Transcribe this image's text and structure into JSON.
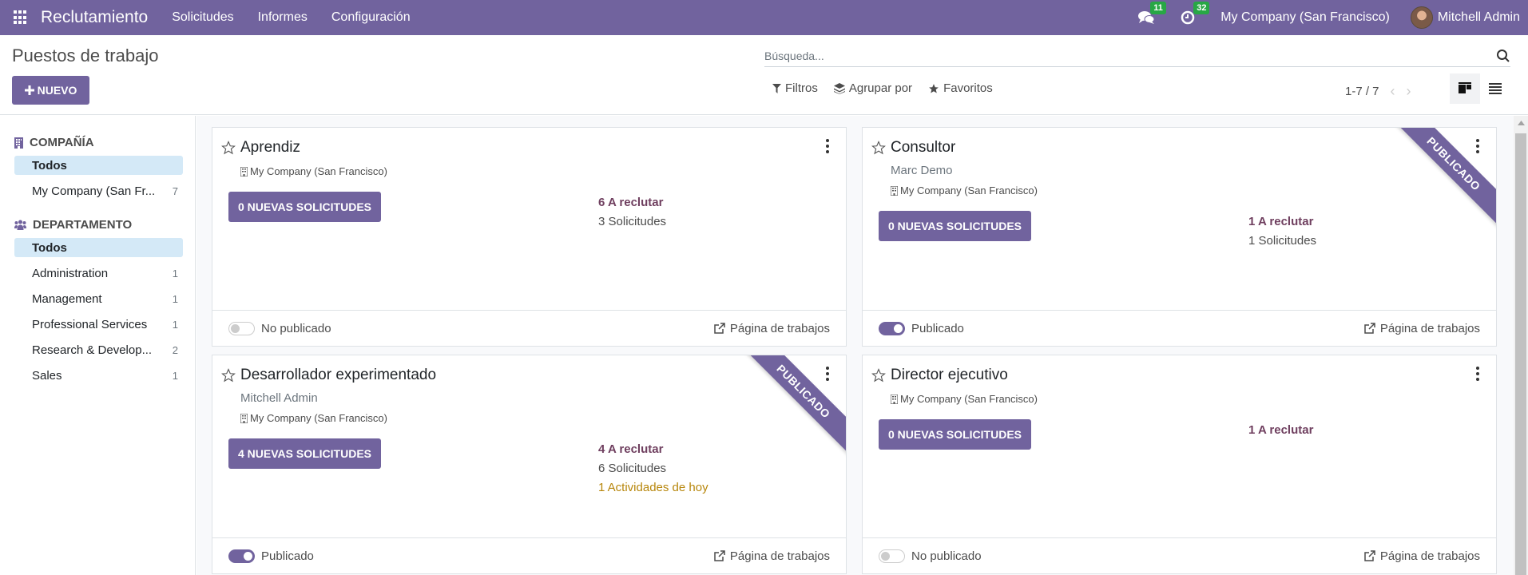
{
  "navbar": {
    "app_name": "Reclutamiento",
    "menu": [
      "Solicitudes",
      "Informes",
      "Configuración"
    ],
    "messages_count": "11",
    "activities_count": "32",
    "company": "My Company (San Francisco)",
    "user": "Mitchell Admin"
  },
  "control_panel": {
    "title": "Puestos de trabajo",
    "new_label": "NUEVO",
    "search_placeholder": "Búsqueda...",
    "filters_label": "Filtros",
    "groupby_label": "Agrupar por",
    "favorites_label": "Favoritos",
    "pager": "1-7 / 7"
  },
  "sidebar": {
    "company_title": "COMPAÑÍA",
    "company_items": [
      {
        "label": "Todos",
        "count": "",
        "active": true
      },
      {
        "label": "My Company (San Fr...",
        "count": "7",
        "active": false
      }
    ],
    "department_title": "DEPARTAMENTO",
    "department_items": [
      {
        "label": "Todos",
        "count": "",
        "active": true
      },
      {
        "label": "Administration",
        "count": "1",
        "active": false
      },
      {
        "label": "Management",
        "count": "1",
        "active": false
      },
      {
        "label": "Professional Services",
        "count": "1",
        "active": false
      },
      {
        "label": "Research & Develop...",
        "count": "2",
        "active": false
      },
      {
        "label": "Sales",
        "count": "1",
        "active": false
      }
    ]
  },
  "cards": [
    {
      "title": "Aprendiz",
      "user": "",
      "company": "My Company (San Francisco)",
      "new_apps_label": "0 NUEVAS SOLICITUDES",
      "to_recruit": "6 A reclutar",
      "applications": "3 Solicitudes",
      "activities": "",
      "published": false,
      "status_label": "No publicado",
      "ribbon": "",
      "job_page_label": "Página de trabajos"
    },
    {
      "title": "Consultor",
      "user": "Marc Demo",
      "company": "My Company (San Francisco)",
      "new_apps_label": "0 NUEVAS SOLICITUDES",
      "to_recruit": "1 A reclutar",
      "applications": "1 Solicitudes",
      "activities": "",
      "published": true,
      "status_label": "Publicado",
      "ribbon": "PUBLICADO",
      "job_page_label": "Página de trabajos"
    },
    {
      "title": "Desarrollador experimentado",
      "user": "Mitchell Admin",
      "company": "My Company (San Francisco)",
      "new_apps_label": "4 NUEVAS SOLICITUDES",
      "to_recruit": "4 A reclutar",
      "applications": "6 Solicitudes",
      "activities": "1 Actividades de hoy",
      "published": true,
      "status_label": "Publicado",
      "ribbon": "PUBLICADO",
      "job_page_label": "Página de trabajos"
    },
    {
      "title": "Director ejecutivo",
      "user": "",
      "company": "My Company (San Francisco)",
      "new_apps_label": "0 NUEVAS SOLICITUDES",
      "to_recruit": "1 A reclutar",
      "applications": "",
      "activities": "",
      "published": false,
      "status_label": "No publicado",
      "ribbon": "",
      "job_page_label": "Página de trabajos"
    }
  ],
  "colors": {
    "brand": "#71639e",
    "badge": "#28a745",
    "active_filter": "#d4e9f7",
    "recruit_text": "#6f3f5f",
    "activity_text": "#b7860b"
  }
}
